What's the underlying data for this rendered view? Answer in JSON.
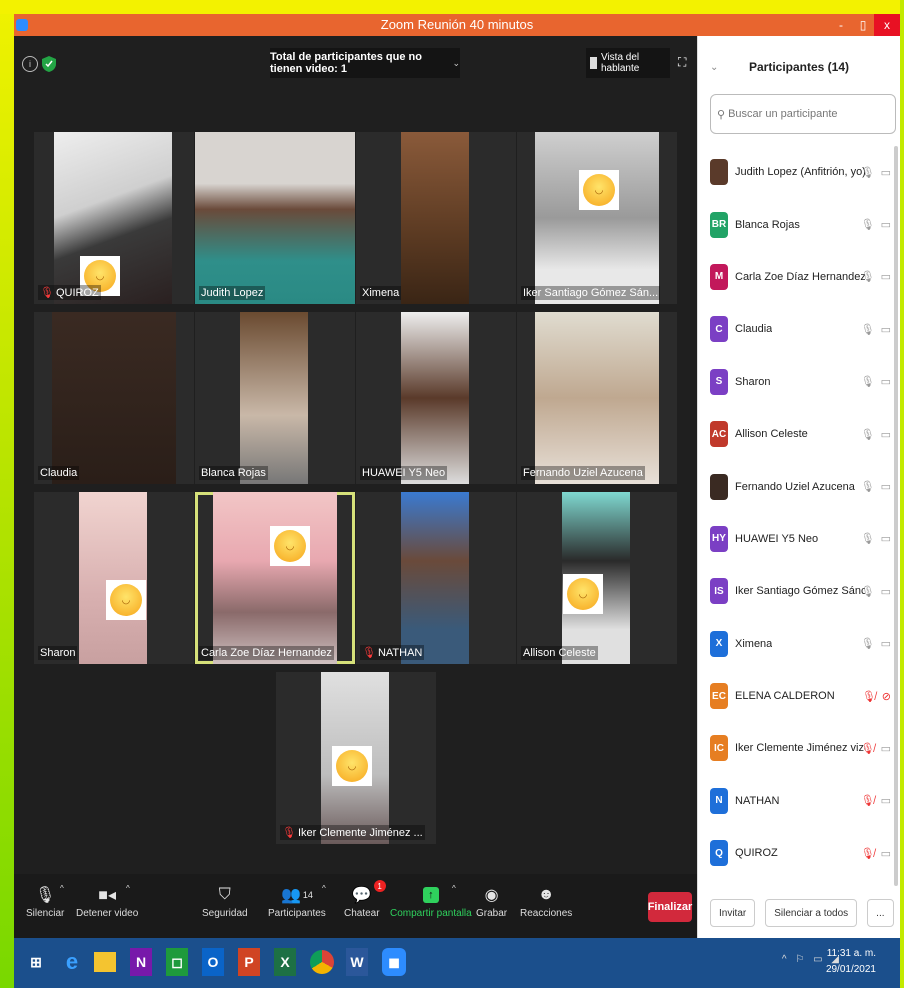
{
  "window": {
    "title": "Zoom Reunión 40 minutos",
    "min_label": "-",
    "max_label": "▯",
    "close_label": "x"
  },
  "topbar": {
    "video_notice": "Total de participantes que no tienen video: 1",
    "speaker_view": "Vista del hablante"
  },
  "tiles": [
    {
      "name": "QUIROZ",
      "muted": true
    },
    {
      "name": "Judith Lopez",
      "muted": false
    },
    {
      "name": "Ximena",
      "muted": false
    },
    {
      "name": "Iker Santiago Gómez Sán...",
      "muted": false
    },
    {
      "name": "Claudia",
      "muted": false
    },
    {
      "name": "Blanca Rojas",
      "muted": false
    },
    {
      "name": "HUAWEI Y5 Neo",
      "muted": false
    },
    {
      "name": "Fernando Uziel Azucena",
      "muted": false
    },
    {
      "name": "Sharon",
      "muted": false
    },
    {
      "name": "Carla Zoe Díaz Hernandez",
      "muted": false
    },
    {
      "name": "NATHAN",
      "muted": true
    },
    {
      "name": "Allison Celeste",
      "muted": false
    },
    {
      "name": "Iker Clemente Jiménez ...",
      "muted": true
    }
  ],
  "toolbar": {
    "mute": "Silenciar",
    "stop_video": "Detener video",
    "security": "Seguridad",
    "participants": "Participantes",
    "participants_count": "14",
    "chat": "Chatear",
    "chat_badge": "1",
    "share": "Compartir pantalla",
    "record": "Grabar",
    "reactions": "Reacciones",
    "end": "Finalizar"
  },
  "panel": {
    "title": "Participantes (14)",
    "search_placeholder": "Buscar un participante",
    "invite": "Invitar",
    "mute_all": "Silenciar a todos",
    "more": "...",
    "participants": [
      {
        "initials": "",
        "name": "Judith Lopez (Anfitrión, yo)",
        "color": "#5a3a2a",
        "muted": false,
        "video_off": false
      },
      {
        "initials": "BR",
        "name": "Blanca Rojas",
        "color": "#21a366",
        "muted": false,
        "video_off": false
      },
      {
        "initials": "M",
        "name": "Carla Zoe Díaz Hernandez",
        "color": "#c2185b",
        "muted": false,
        "video_off": false
      },
      {
        "initials": "C",
        "name": "Claudia",
        "color": "#7b3fc4",
        "muted": false,
        "video_off": false
      },
      {
        "initials": "S",
        "name": "Sharon",
        "color": "#7b3fc4",
        "muted": false,
        "video_off": false
      },
      {
        "initials": "AC",
        "name": "Allison Celeste",
        "color": "#c0392b",
        "muted": false,
        "video_off": false
      },
      {
        "initials": "",
        "name": "Fernando Uziel Azucena",
        "color": "#3a2a22",
        "muted": false,
        "video_off": false
      },
      {
        "initials": "HY",
        "name": "HUAWEI Y5 Neo",
        "color": "#7b3fc4",
        "muted": false,
        "video_off": false
      },
      {
        "initials": "IS",
        "name": "Iker Santiago Gómez Sánchez",
        "color": "#7b3fc4",
        "muted": false,
        "video_off": false
      },
      {
        "initials": "X",
        "name": "Ximena",
        "color": "#1e6fd9",
        "muted": false,
        "video_off": false
      },
      {
        "initials": "EC",
        "name": "ELENA CALDERON",
        "color": "#e67e22",
        "muted": true,
        "video_off": true
      },
      {
        "initials": "IC",
        "name": "Iker Clemente Jiménez vizcaya",
        "color": "#e67e22",
        "muted": true,
        "video_off": false
      },
      {
        "initials": "N",
        "name": "NATHAN",
        "color": "#1e6fd9",
        "muted": true,
        "video_off": false
      },
      {
        "initials": "Q",
        "name": "QUIROZ",
        "color": "#1e6fd9",
        "muted": true,
        "video_off": false
      }
    ]
  },
  "taskbar": {
    "time": "11:31 a. m.",
    "date": "29/01/2021",
    "apps": [
      "windows-start",
      "edge",
      "file-explorer",
      "onenote",
      "store",
      "outlook",
      "powerpoint",
      "excel",
      "chrome",
      "word",
      "zoom"
    ]
  }
}
